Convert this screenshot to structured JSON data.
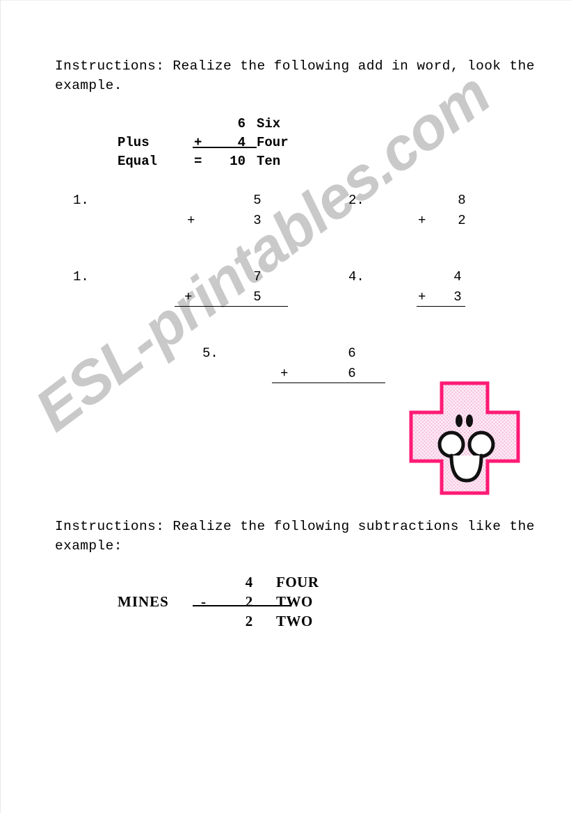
{
  "watermark": {
    "text": "ESL-printables.com",
    "color": "#c9c9c9"
  },
  "section_add": {
    "instructions": "Instructions: Realize the following add in word, look the example.",
    "example": {
      "rows": [
        {
          "label": "",
          "op": "",
          "num": "6",
          "word": "Six"
        },
        {
          "label": "Plus",
          "op": "+",
          "num": "4",
          "word": "Four"
        },
        {
          "label": "Equal",
          "op": "=",
          "num": "10",
          "word": "Ten"
        }
      ]
    },
    "problems": [
      {
        "index": "1.",
        "top": "5",
        "op": "+",
        "bottom": "3",
        "rule": false
      },
      {
        "index": "2.",
        "top": "8",
        "op": "+",
        "bottom": "2",
        "rule": false
      },
      {
        "index": "1.",
        "top": "7",
        "op": "+",
        "bottom": "5",
        "rule": true
      },
      {
        "index": "4.",
        "top": "4",
        "op": "+",
        "bottom": "3",
        "rule": true
      },
      {
        "index": "5.",
        "top": "6",
        "op": "+",
        "bottom": "6",
        "rule": true
      }
    ]
  },
  "section_sub": {
    "instructions": "Instructions: Realize the following subtractions like the example:",
    "example": {
      "rows": [
        {
          "label": "",
          "op": "",
          "num": "4",
          "word": "FOUR"
        },
        {
          "label": "MINES",
          "op": "-",
          "num": "2",
          "word": "TWO"
        },
        {
          "label": "",
          "op": "",
          "num": "2",
          "word": "TWO"
        }
      ]
    }
  },
  "decoration": {
    "name": "smiley-plus-character",
    "fill": "#fbe4f1",
    "border": "#ff1a75",
    "dot": "#f5b9dc",
    "face": "#000000"
  }
}
